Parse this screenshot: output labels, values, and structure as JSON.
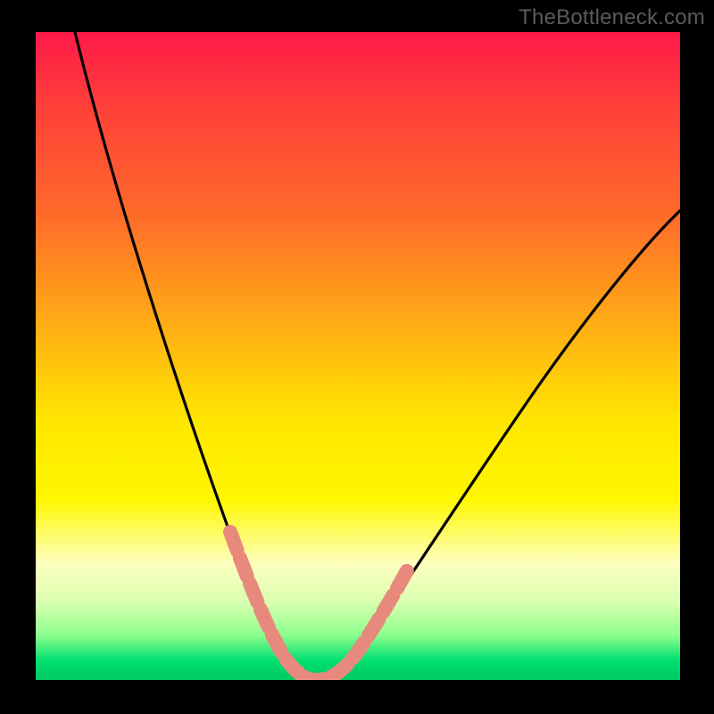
{
  "watermark": "TheBottleneck.com",
  "chart_data": {
    "type": "line",
    "title": "",
    "xlabel": "",
    "ylabel": "",
    "xlim": [
      0,
      100
    ],
    "ylim": [
      0,
      100
    ],
    "series": [
      {
        "name": "bottleneck-curve",
        "x": [
          6,
          10,
          15,
          20,
          24,
          28,
          31,
          33,
          35,
          37,
          40,
          44,
          47,
          50,
          55,
          60,
          66,
          74,
          82,
          90,
          100
        ],
        "y": [
          100,
          85,
          68,
          52,
          40,
          28,
          18,
          12,
          7,
          3,
          0,
          0,
          2,
          6,
          12,
          20,
          29,
          40,
          50,
          58,
          66
        ]
      }
    ],
    "highlight_band": {
      "name": "optimal-range",
      "x_range": [
        30,
        55
      ],
      "y_max": 21
    },
    "background_gradient": {
      "top": "#ff1a4a",
      "mid": "#ffe600",
      "bottom": "#00c862"
    }
  }
}
